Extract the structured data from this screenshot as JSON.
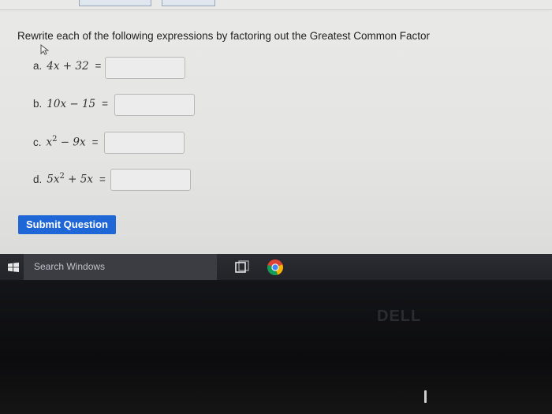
{
  "instructions": "Rewrite each of the following expressions by factoring out the Greatest Common Factor",
  "questions": [
    {
      "label": "a.",
      "expr": "4x + 32",
      "eq": "="
    },
    {
      "label": "b.",
      "expr": "10x − 15",
      "eq": "="
    },
    {
      "label": "c.",
      "expr_base": "x",
      "expr_exp": "2",
      "expr_rest": " − 9x",
      "eq": "="
    },
    {
      "label": "d.",
      "expr_base": "5x",
      "expr_exp": "2",
      "expr_rest": " + 5x",
      "eq": "="
    }
  ],
  "submit_label": "Submit Question",
  "taskbar": {
    "search_placeholder": "Search Windows"
  },
  "brand": "DELL"
}
